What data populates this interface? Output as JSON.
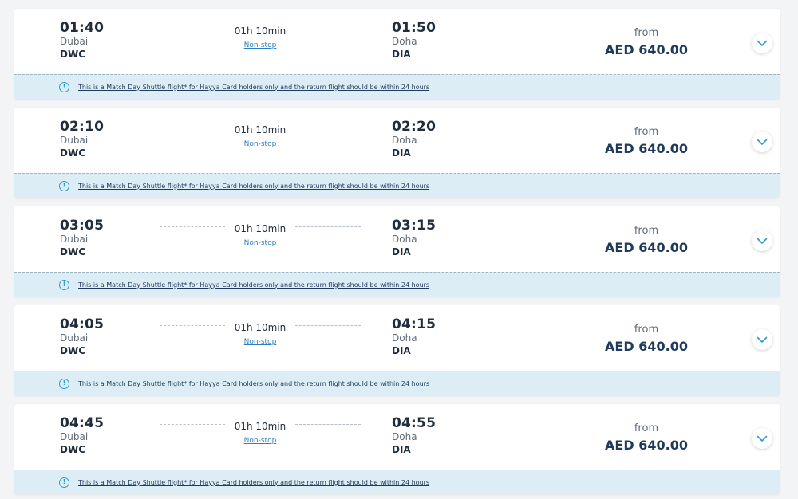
{
  "flights": [
    {
      "departure": {
        "time": "01:40",
        "city": "Dubai",
        "code": "DWC"
      },
      "arrival": {
        "time": "01:50",
        "city": "Doha",
        "code": "DIA"
      },
      "duration": "01h 10min",
      "stops": "Non-stop",
      "price_prefix": "from",
      "price": "AED 640.00",
      "notice": "This is a Match Day Shuttle flight* for Hayya Card holders only and the return flight should be within 24 hours"
    },
    {
      "departure": {
        "time": "02:10",
        "city": "Dubai",
        "code": "DWC"
      },
      "arrival": {
        "time": "02:20",
        "city": "Doha",
        "code": "DIA"
      },
      "duration": "01h 10min",
      "stops": "Non-stop",
      "price_prefix": "from",
      "price": "AED 640.00",
      "notice": "This is a Match Day Shuttle flight* for Hayya Card holders only and the return flight should be within 24 hours"
    },
    {
      "departure": {
        "time": "03:05",
        "city": "Dubai",
        "code": "DWC"
      },
      "arrival": {
        "time": "03:15",
        "city": "Doha",
        "code": "DIA"
      },
      "duration": "01h 10min",
      "stops": "Non-stop",
      "price_prefix": "from",
      "price": "AED 640.00",
      "notice": "This is a Match Day Shuttle flight* for Hayya Card holders only and the return flight should be within 24 hours"
    },
    {
      "departure": {
        "time": "04:05",
        "city": "Dubai",
        "code": "DWC"
      },
      "arrival": {
        "time": "04:15",
        "city": "Doha",
        "code": "DIA"
      },
      "duration": "01h 10min",
      "stops": "Non-stop",
      "price_prefix": "from",
      "price": "AED 640.00",
      "notice": "This is a Match Day Shuttle flight* for Hayya Card holders only and the return flight should be within 24 hours"
    },
    {
      "departure": {
        "time": "04:45",
        "city": "Dubai",
        "code": "DWC"
      },
      "arrival": {
        "time": "04:55",
        "city": "Doha",
        "code": "DIA"
      },
      "duration": "01h 10min",
      "stops": "Non-stop",
      "price_prefix": "from",
      "price": "AED 640.00",
      "notice": "This is a Match Day Shuttle flight* for Hayya Card holders only and the return flight should be within 24 hours"
    }
  ],
  "icons": {
    "expand": "chevron-down-icon",
    "info": "info-icon",
    "info_glyph": "!"
  },
  "colors": {
    "accent": "#2f9bd0",
    "link": "#2f7fbf",
    "price": "#1f3a5a",
    "notice_bg": "#dcedf6"
  }
}
